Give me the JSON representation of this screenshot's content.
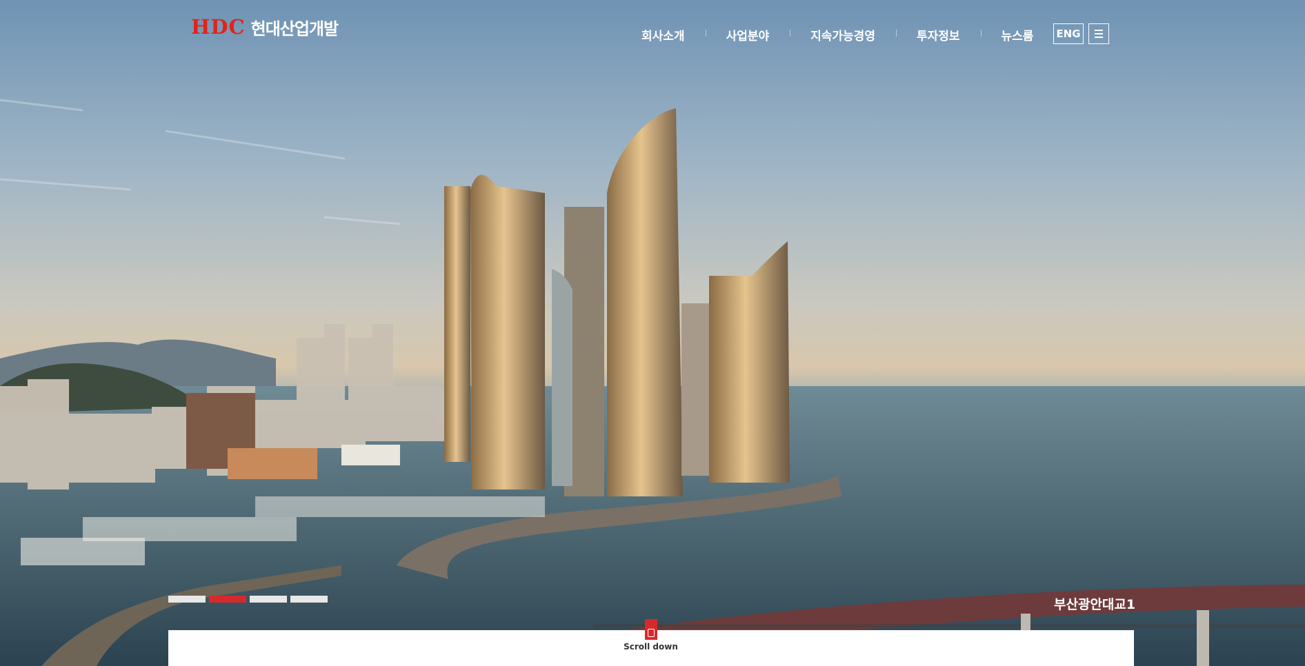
{
  "brand": {
    "mark": "HDC",
    "name": "현대산업개발",
    "mark_color": "#e2231a"
  },
  "nav": {
    "items": [
      {
        "label": "회사소개"
      },
      {
        "label": "사업분야"
      },
      {
        "label": "지속가능경영"
      },
      {
        "label": "투자정보"
      },
      {
        "label": "뉴스룸"
      }
    ],
    "lang_label": "ENG",
    "menu_icon": "hamburger-icon"
  },
  "hero": {
    "caption": "부산광안대교1",
    "slides": {
      "total": 4,
      "active_index": 1
    },
    "accent_color": "#d7282b"
  },
  "scroll": {
    "label": "Scroll down",
    "icon": "mouse-icon"
  }
}
